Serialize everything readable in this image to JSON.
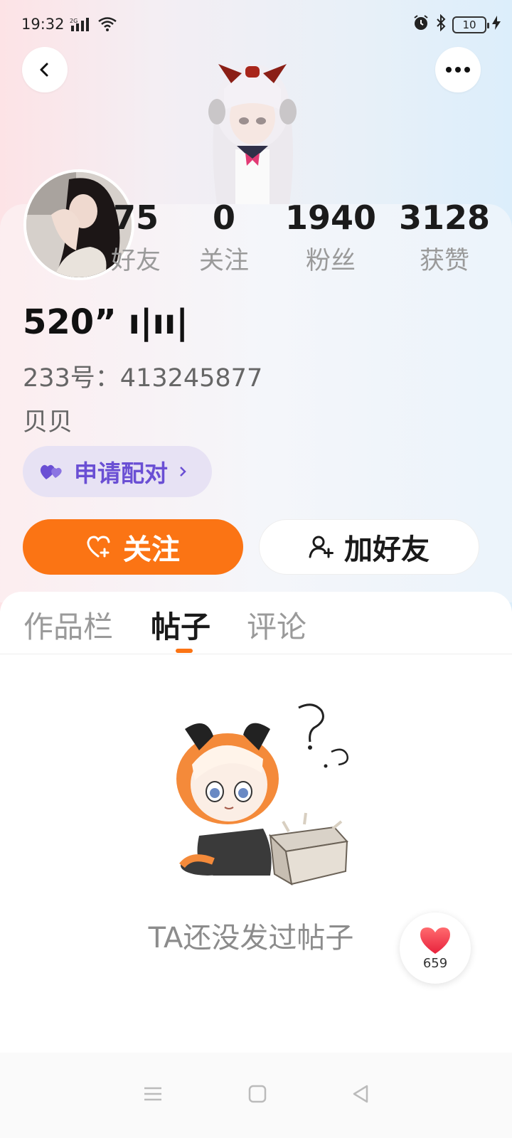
{
  "status_bar": {
    "time": "19:32",
    "network": "2G",
    "battery": "10"
  },
  "profile": {
    "stats": [
      {
        "value": "75",
        "label": "好友"
      },
      {
        "value": "0",
        "label": "关注"
      },
      {
        "value": "1940",
        "label": "粉丝"
      },
      {
        "value": "3128",
        "label": "获赞"
      }
    ],
    "nickname": "520” ı|ıı|",
    "id_line": "233号：413245877",
    "bio": "贝贝",
    "pair_label": "申请配对"
  },
  "actions": {
    "follow_label": "关注",
    "add_friend_label": "加好友"
  },
  "tabs": [
    {
      "label": "作品栏"
    },
    {
      "label": "帖子"
    },
    {
      "label": "评论"
    }
  ],
  "empty_state": {
    "text": "TA还没发过帖子"
  },
  "like_fab": {
    "count": "659"
  },
  "colors": {
    "accent": "#fb7414",
    "pair": "#6a4fd4",
    "like": "#f33a4e"
  }
}
